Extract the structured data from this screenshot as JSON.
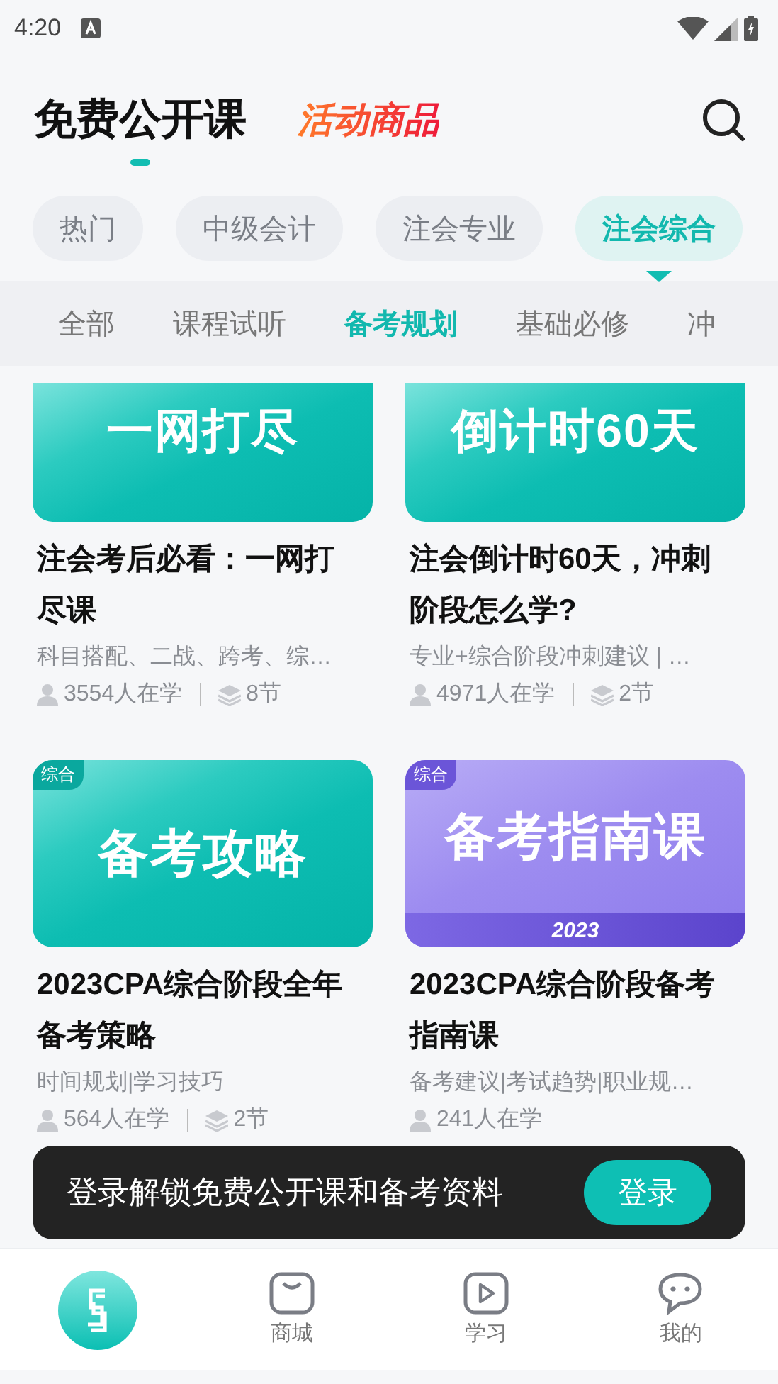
{
  "status_bar": {
    "time": "4:20"
  },
  "header": {
    "tabs": [
      {
        "label": "免费公开课",
        "kind": "plain",
        "selected": true
      },
      {
        "label": "活动商品",
        "kind": "promo",
        "selected": false
      }
    ]
  },
  "categories": [
    {
      "label": "热门",
      "selected": false
    },
    {
      "label": "中级会计",
      "selected": false
    },
    {
      "label": "注会专业",
      "selected": false
    },
    {
      "label": "注会综合",
      "selected": true
    }
  ],
  "subcategories": [
    {
      "label": "全部",
      "selected": false
    },
    {
      "label": "课程试听",
      "selected": false
    },
    {
      "label": "备考规划",
      "selected": true
    },
    {
      "label": "基础必修",
      "selected": false
    },
    {
      "label": "冲",
      "selected": false
    }
  ],
  "courses": [
    {
      "cover": {
        "kind": "teal",
        "text": "一网打尽"
      },
      "title": "注会考后必看：一网打尽课",
      "subtitle": "科目搭配、二战、跨考、综…",
      "learners": "3554人在学",
      "lessons": "8节"
    },
    {
      "cover": {
        "kind": "teal",
        "text": "倒计时60天"
      },
      "title": "注会倒计时60天，冲刺阶段怎么学?",
      "subtitle": "专业+综合阶段冲刺建议 | …",
      "learners": "4971人在学",
      "lessons": "2节"
    },
    {
      "cover": {
        "kind": "teal",
        "tag": "综合",
        "text": "备考攻略"
      },
      "title": "2023CPA综合阶段全年备考策略",
      "subtitle": "时间规划|学习技巧",
      "learners": "564人在学",
      "lessons": "2节"
    },
    {
      "cover": {
        "kind": "purple",
        "tag": "综合",
        "text": "备考指南课",
        "ribbon": "2023"
      },
      "title": "2023CPA综合阶段备考指南课",
      "subtitle": "备考建议|考试趋势|职业规…",
      "learners": "241人在学"
    }
  ],
  "toast": {
    "text": "登录解锁免费公开课和备考资料",
    "button": "登录"
  },
  "nav": [
    {
      "kind": "home",
      "selected": true
    },
    {
      "kind": "shop",
      "label": "商城",
      "selected": false
    },
    {
      "kind": "play",
      "label": "学习",
      "selected": false
    },
    {
      "kind": "chat",
      "label": "我的",
      "selected": false
    }
  ]
}
